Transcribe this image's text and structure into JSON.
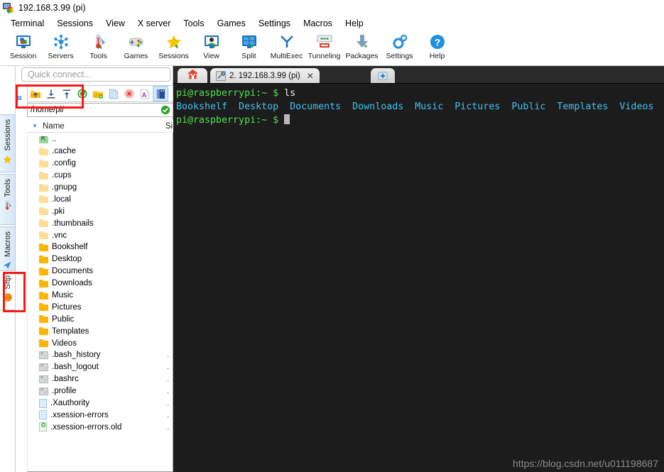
{
  "window": {
    "title": "192.168.3.99 (pi)",
    "icon": "mobaxterm-app-icon"
  },
  "menubar": {
    "items": [
      "Terminal",
      "Sessions",
      "View",
      "X server",
      "Tools",
      "Games",
      "Settings",
      "Macros",
      "Help"
    ]
  },
  "ribbon": {
    "items": [
      {
        "label": "Session",
        "icon": "session-icon"
      },
      {
        "label": "Servers",
        "icon": "servers-icon"
      },
      {
        "label": "Tools",
        "icon": "tools-icon"
      },
      {
        "label": "Games",
        "icon": "games-gamepad-icon"
      },
      {
        "label": "Sessions",
        "icon": "sessions-star-icon"
      },
      {
        "label": "View",
        "icon": "view-monitor-icon"
      },
      {
        "label": "Split",
        "icon": "split-icon"
      },
      {
        "label": "MultiExec",
        "icon": "multiexec-fork-icon"
      },
      {
        "label": "Tunneling",
        "icon": "tunneling-icon"
      },
      {
        "label": "Packages",
        "icon": "packages-download-icon"
      },
      {
        "label": "Settings",
        "icon": "settings-gear-icon"
      },
      {
        "label": "Help",
        "icon": "help-question-icon"
      }
    ]
  },
  "sidebar": {
    "tabs": [
      {
        "label": "Sessions",
        "icon": "star-icon",
        "selected": false
      },
      {
        "label": "Tools",
        "icon": "thermometer-icon",
        "selected": false
      },
      {
        "label": "Macros",
        "icon": "cursor-arrow-icon",
        "selected": false
      },
      {
        "label": "Sftp",
        "icon": "globe-icon",
        "selected": true
      }
    ]
  },
  "quick_connect": {
    "placeholder": "Quick connect...",
    "value": ""
  },
  "collapse_button": {
    "label": "«"
  },
  "sftp": {
    "toolbar": [
      {
        "name": "parent-directory-button",
        "icon": "folder-up-icon",
        "active": false
      },
      {
        "name": "download-button",
        "icon": "download-icon",
        "active": false
      },
      {
        "name": "upload-button",
        "icon": "upload-icon",
        "active": false
      },
      {
        "name": "refresh-button",
        "icon": "refresh-icon",
        "active": false
      },
      {
        "name": "new-folder-button",
        "icon": "new-folder-icon",
        "active": false
      },
      {
        "name": "new-file-button",
        "icon": "new-file-icon",
        "active": false
      },
      {
        "name": "delete-button",
        "icon": "delete-icon",
        "active": false
      },
      {
        "name": "rename-button",
        "icon": "rename-icon",
        "active": false
      },
      {
        "name": "follow-terminal-folder-button",
        "icon": "book-drive-icon",
        "active": true
      }
    ],
    "path": "/home/pi/",
    "path_status": "ok",
    "columns": [
      "Name",
      "Size"
    ],
    "sort": "ascending",
    "files": [
      {
        "name": "..",
        "icon": "folder-up-icon",
        "size": ""
      },
      {
        "name": ".cache",
        "icon": "folder-dim-icon",
        "size": ""
      },
      {
        "name": ".config",
        "icon": "folder-dim-icon",
        "size": ""
      },
      {
        "name": ".cups",
        "icon": "folder-dim-icon",
        "size": ""
      },
      {
        "name": ".gnupg",
        "icon": "folder-dim-icon",
        "size": ""
      },
      {
        "name": ".local",
        "icon": "folder-dim-icon",
        "size": ""
      },
      {
        "name": ".pki",
        "icon": "folder-dim-icon",
        "size": ""
      },
      {
        "name": ".thumbnails",
        "icon": "folder-dim-icon",
        "size": ""
      },
      {
        "name": ".vnc",
        "icon": "folder-dim-icon",
        "size": ""
      },
      {
        "name": "Bookshelf",
        "icon": "folder-icon",
        "size": ""
      },
      {
        "name": "Desktop",
        "icon": "folder-icon",
        "size": ""
      },
      {
        "name": "Documents",
        "icon": "folder-icon",
        "size": ""
      },
      {
        "name": "Downloads",
        "icon": "folder-icon",
        "size": ""
      },
      {
        "name": "Music",
        "icon": "folder-icon",
        "size": ""
      },
      {
        "name": "Pictures",
        "icon": "folder-icon",
        "size": ""
      },
      {
        "name": "Public",
        "icon": "folder-icon",
        "size": ""
      },
      {
        "name": "Templates",
        "icon": "folder-icon",
        "size": ""
      },
      {
        "name": "Videos",
        "icon": "folder-icon",
        "size": ""
      },
      {
        "name": ".bash_history",
        "icon": "shell-file-icon",
        "size": "."
      },
      {
        "name": ".bash_logout",
        "icon": "shell-file-icon",
        "size": "."
      },
      {
        "name": ".bashrc",
        "icon": "shell-file-icon",
        "size": "."
      },
      {
        "name": ".profile",
        "icon": "shell-file-icon",
        "size": "."
      },
      {
        "name": ".Xauthority",
        "icon": "plain-file-icon",
        "size": "."
      },
      {
        "name": ".xsession-errors",
        "icon": "plain-file-icon",
        "size": "."
      },
      {
        "name": ".xsession-errors.old",
        "icon": "recycle-file-icon",
        "size": "."
      }
    ]
  },
  "terminal": {
    "tabs": [
      {
        "label": "",
        "icon": "home-icon",
        "name": "home-tab",
        "closable": false
      },
      {
        "label": "2. 192.168.3.99 (pi)",
        "icon": "wrench-icon",
        "name": "session-tab",
        "closable": true,
        "close_label": "✕"
      },
      {
        "label": "✚",
        "icon": "add-tab-icon",
        "name": "add-tab",
        "closable": false
      }
    ],
    "lines": [
      {
        "segments": [
          {
            "text": "pi@raspberrypi",
            "color": "green"
          },
          {
            "text": ":~ ",
            "color": "green"
          },
          {
            "text": "$ ",
            "color": "green"
          },
          {
            "text": "ls",
            "color": "white"
          }
        ]
      },
      {
        "segments": [
          {
            "text": "Bookshelf  Desktop  Documents  Downloads  Music  Pictures  Public  Templates  Videos",
            "color": "blue"
          }
        ]
      },
      {
        "segments": [
          {
            "text": "pi@raspberrypi",
            "color": "green"
          },
          {
            "text": ":~ ",
            "color": "green"
          },
          {
            "text": "$ ",
            "color": "green"
          },
          {
            "text": "█",
            "color": "cursor"
          }
        ]
      }
    ],
    "colors": {
      "background": "#1c1c1c",
      "prompt": "#4ee24e",
      "directory": "#3fc0ef",
      "command": "#f0f0f0"
    }
  },
  "watermark": {
    "text": "https://blog.csdn.net/u011198687"
  },
  "annotations": {
    "accent_color": "#fb1714",
    "boxes": [
      "sftp-toolbar-highlight",
      "sftp-sidebar-tab-highlight"
    ]
  }
}
